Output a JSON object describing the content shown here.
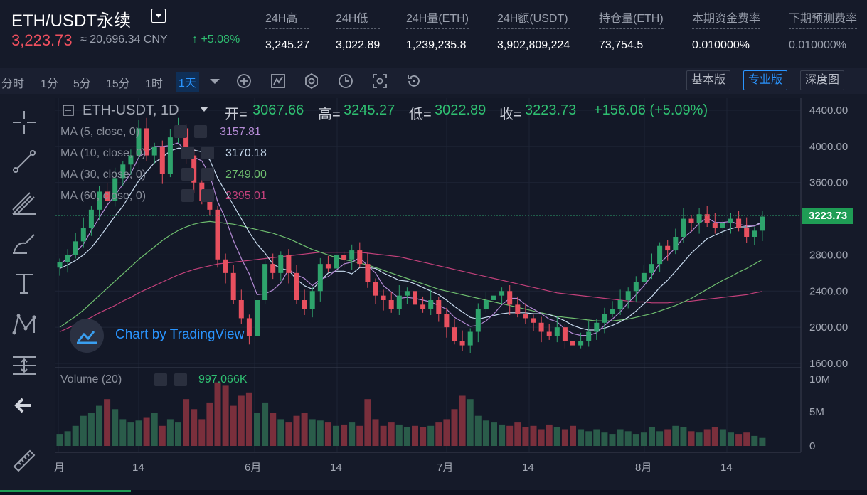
{
  "header": {
    "symbol": "ETH/USDT永续",
    "price": "3,223.73",
    "cny": "≈ 20,696.34 CNY",
    "change_arrow": "↑",
    "change": "+5.08%",
    "stats": [
      {
        "label": "24H高",
        "value": "3,245.27"
      },
      {
        "label": "24H低",
        "value": "3,022.89"
      },
      {
        "label": "24H量(ETH)",
        "value": "1,239,235.8"
      },
      {
        "label": "24H额(USDT)",
        "value": "3,902,809,224"
      },
      {
        "label": "持仓量(ETH)",
        "value": "73,754.5"
      },
      {
        "label": "本期资金费率",
        "value": "0.010000%"
      },
      {
        "label": "下期预测费率",
        "value": "0.010000%"
      }
    ]
  },
  "toolbar": {
    "timeframes": [
      "分时",
      "1分",
      "5分",
      "15分",
      "1时",
      "1天"
    ],
    "active_timeframe": "1天",
    "versions": [
      "基本版",
      "专业版",
      "深度图"
    ],
    "active_version": "专业版",
    "tool_icons": [
      "dropdown-icon",
      "add-indicator-icon",
      "chart-type-icon",
      "settings-icon",
      "clock-icon",
      "screenshot-icon",
      "replay-icon"
    ]
  },
  "leftbar": {
    "icons": [
      "crosshair-icon",
      "trendline-icon",
      "fib-icon",
      "brush-icon",
      "text-icon",
      "pattern-icon",
      "measure-icon",
      "back-arrow-icon",
      "ruler-icon"
    ]
  },
  "legend": {
    "title": "ETH-USDT, 1D",
    "ohlc": [
      {
        "label": "开=",
        "value": "3067.66"
      },
      {
        "label": "高=",
        "value": "3245.27"
      },
      {
        "label": "低=",
        "value": "3022.89"
      },
      {
        "label": "收=",
        "value": "3223.73"
      }
    ],
    "change": "+156.06 (+5.09%)",
    "ma": [
      {
        "label": "MA (5, close, 0)",
        "value": "3157.81",
        "color": "#b58bd6"
      },
      {
        "label": "MA (10, close, 0)",
        "value": "3170.18",
        "color": "#c9dcf0"
      },
      {
        "label": "MA (30, close, 0)",
        "value": "2749.00",
        "color": "#6fbf6f"
      },
      {
        "label": "MA (60, close, 0)",
        "value": "2395.01",
        "color": "#c2407a"
      }
    ],
    "volume_label": "Volume (20)",
    "volume_value": "997.066K"
  },
  "watermark": "Chart by TradingView",
  "last_price_tag": "3223.73",
  "chart_data": {
    "type": "candlestick",
    "price_axis_labels": [
      "4400.00",
      "4000.00",
      "3600.00",
      "2800.00",
      "2400.00",
      "2000.00",
      "1600.00"
    ],
    "volume_axis_labels": [
      "10M",
      "5M",
      "0"
    ],
    "time_axis_labels": [
      "月",
      "14",
      "6月",
      "14",
      "7月",
      "14",
      "8月",
      "14"
    ],
    "ylim": [
      1600,
      4400
    ],
    "colors": {
      "up": "#2ea36c",
      "down": "#e8505f",
      "ma5": "#b58bd6",
      "ma10": "#c9dcf0",
      "ma30": "#6fbf6f",
      "ma60": "#c2407a"
    },
    "closes": [
      2720,
      2800,
      2950,
      3100,
      3300,
      3500,
      3400,
      3650,
      3800,
      3900,
      4200,
      3900,
      4000,
      3700,
      4100,
      4200,
      3900,
      3600,
      3400,
      3300,
      2750,
      2600,
      2300,
      2100,
      1900,
      2300,
      2700,
      2600,
      2800,
      2600,
      2300,
      2200,
      2400,
      2700,
      2650,
      2800,
      2750,
      2850,
      2700,
      2500,
      2350,
      2300,
      2200,
      2350,
      2400,
      2250,
      2200,
      2300,
      2150,
      2000,
      1850,
      1800,
      1950,
      2200,
      2300,
      2350,
      2400,
      2250,
      2150,
      2100,
      2050,
      1950,
      1900,
      2000,
      1850,
      1800,
      1850,
      1950,
      2050,
      2150,
      2200,
      2300,
      2400,
      2500,
      2600,
      2700,
      2900,
      2850,
      3000,
      3200,
      3150,
      3250,
      3150,
      3100,
      3150,
      3200,
      3100,
      3000,
      3068,
      3224
    ],
    "ma5": [
      2700,
      2760,
      2830,
      2920,
      3070,
      3210,
      3350,
      3460,
      3580,
      3700,
      3880,
      3940,
      4000,
      4000,
      4010,
      4040,
      3940,
      3880,
      3840,
      3680,
      3390,
      3200,
      2960,
      2760,
      2590,
      2360,
      2370,
      2410,
      2490,
      2640,
      2580,
      2540,
      2460,
      2530,
      2560,
      2630,
      2700,
      2720,
      2770,
      2680,
      2600,
      2460,
      2390,
      2320,
      2330,
      2320,
      2300,
      2280,
      2240,
      2200,
      2110,
      2060,
      2010,
      2020,
      2070,
      2150,
      2250,
      2320,
      2320,
      2250,
      2200,
      2150,
      2090,
      2060,
      1980,
      1930,
      1910,
      1910,
      1940,
      2020,
      2090,
      2170,
      2270,
      2360,
      2460,
      2570,
      2710,
      2790,
      2880,
      2990,
      3060,
      3150,
      3210,
      3160,
      3160,
      3170,
      3140,
      3120,
      3120,
      3158
    ],
    "ma10": [
      2650,
      2690,
      2740,
      2800,
      2880,
      2990,
      3110,
      3230,
      3340,
      3480,
      3620,
      3720,
      3820,
      3880,
      3950,
      3980,
      3980,
      3960,
      3940,
      3850,
      3650,
      3500,
      3350,
      3200,
      3050,
      2920,
      2820,
      2700,
      2650,
      2630,
      2530,
      2460,
      2420,
      2510,
      2600,
      2620,
      2620,
      2590,
      2660,
      2660,
      2650,
      2600,
      2560,
      2520,
      2510,
      2480,
      2440,
      2400,
      2360,
      2300,
      2230,
      2170,
      2110,
      2090,
      2110,
      2130,
      2150,
      2160,
      2160,
      2160,
      2150,
      2150,
      2140,
      2110,
      2070,
      2020,
      1990,
      1970,
      1970,
      1990,
      2020,
      2060,
      2110,
      2180,
      2260,
      2340,
      2440,
      2520,
      2620,
      2720,
      2820,
      2900,
      2980,
      3020,
      3060,
      3090,
      3110,
      3110,
      3120,
      3170
    ],
    "ma30": [
      2000,
      2060,
      2120,
      2190,
      2270,
      2350,
      2430,
      2510,
      2590,
      2670,
      2750,
      2820,
      2890,
      2960,
      3020,
      3070,
      3110,
      3140,
      3160,
      3170,
      3160,
      3150,
      3140,
      3120,
      3100,
      3080,
      3060,
      3040,
      3010,
      2980,
      2940,
      2900,
      2860,
      2830,
      2800,
      2770,
      2750,
      2730,
      2710,
      2690,
      2660,
      2630,
      2600,
      2570,
      2540,
      2510,
      2480,
      2450,
      2420,
      2400,
      2380,
      2360,
      2340,
      2320,
      2300,
      2280,
      2260,
      2240,
      2220,
      2200,
      2180,
      2160,
      2140,
      2120,
      2110,
      2100,
      2090,
      2080,
      2070,
      2070,
      2070,
      2080,
      2090,
      2110,
      2130,
      2150,
      2180,
      2210,
      2240,
      2280,
      2320,
      2370,
      2420,
      2470,
      2520,
      2560,
      2610,
      2650,
      2700,
      2749
    ],
    "ma60": [
      1950,
      1990,
      2030,
      2070,
      2110,
      2160,
      2200,
      2240,
      2290,
      2330,
      2380,
      2420,
      2460,
      2500,
      2540,
      2580,
      2610,
      2640,
      2660,
      2680,
      2700,
      2710,
      2720,
      2730,
      2740,
      2750,
      2760,
      2770,
      2780,
      2790,
      2800,
      2810,
      2820,
      2830,
      2830,
      2830,
      2830,
      2830,
      2830,
      2820,
      2810,
      2800,
      2790,
      2780,
      2760,
      2740,
      2720,
      2700,
      2680,
      2660,
      2640,
      2620,
      2600,
      2580,
      2560,
      2540,
      2520,
      2500,
      2480,
      2460,
      2440,
      2420,
      2400,
      2380,
      2370,
      2360,
      2350,
      2340,
      2330,
      2320,
      2310,
      2300,
      2290,
      2280,
      2280,
      2270,
      2270,
      2270,
      2280,
      2280,
      2290,
      2300,
      2310,
      2320,
      2330,
      2340,
      2350,
      2360,
      2380,
      2395
    ],
    "volume_m": [
      1.8,
      2.2,
      3.0,
      4.5,
      5.0,
      6.0,
      7.0,
      5.5,
      4.0,
      3.5,
      3.8,
      4.2,
      5.0,
      3.0,
      4.0,
      3.5,
      7.0,
      5.5,
      4.0,
      6.5,
      9.5,
      9.0,
      6.0,
      7.5,
      8.0,
      5.0,
      6.5,
      5.0,
      4.0,
      3.5,
      4.5,
      5.0,
      4.0,
      3.8,
      3.5,
      3.0,
      3.2,
      3.5,
      3.0,
      7.0,
      4.0,
      3.0,
      3.5,
      3.2,
      2.8,
      3.0,
      2.8,
      3.0,
      3.5,
      4.0,
      5.5,
      7.5,
      7.0,
      4.5,
      3.8,
      3.5,
      3.2,
      3.0,
      3.5,
      2.8,
      3.0,
      2.5,
      3.2,
      2.8,
      2.5,
      3.0,
      2.5,
      2.2,
      2.5,
      2.0,
      1.8,
      2.5,
      2.2,
      1.8,
      2.0,
      2.8,
      2.2,
      2.5,
      3.0,
      2.8,
      2.2,
      2.0,
      2.5,
      2.8,
      2.5,
      2.0,
      1.8,
      2.0,
      1.5,
      1.2
    ]
  }
}
